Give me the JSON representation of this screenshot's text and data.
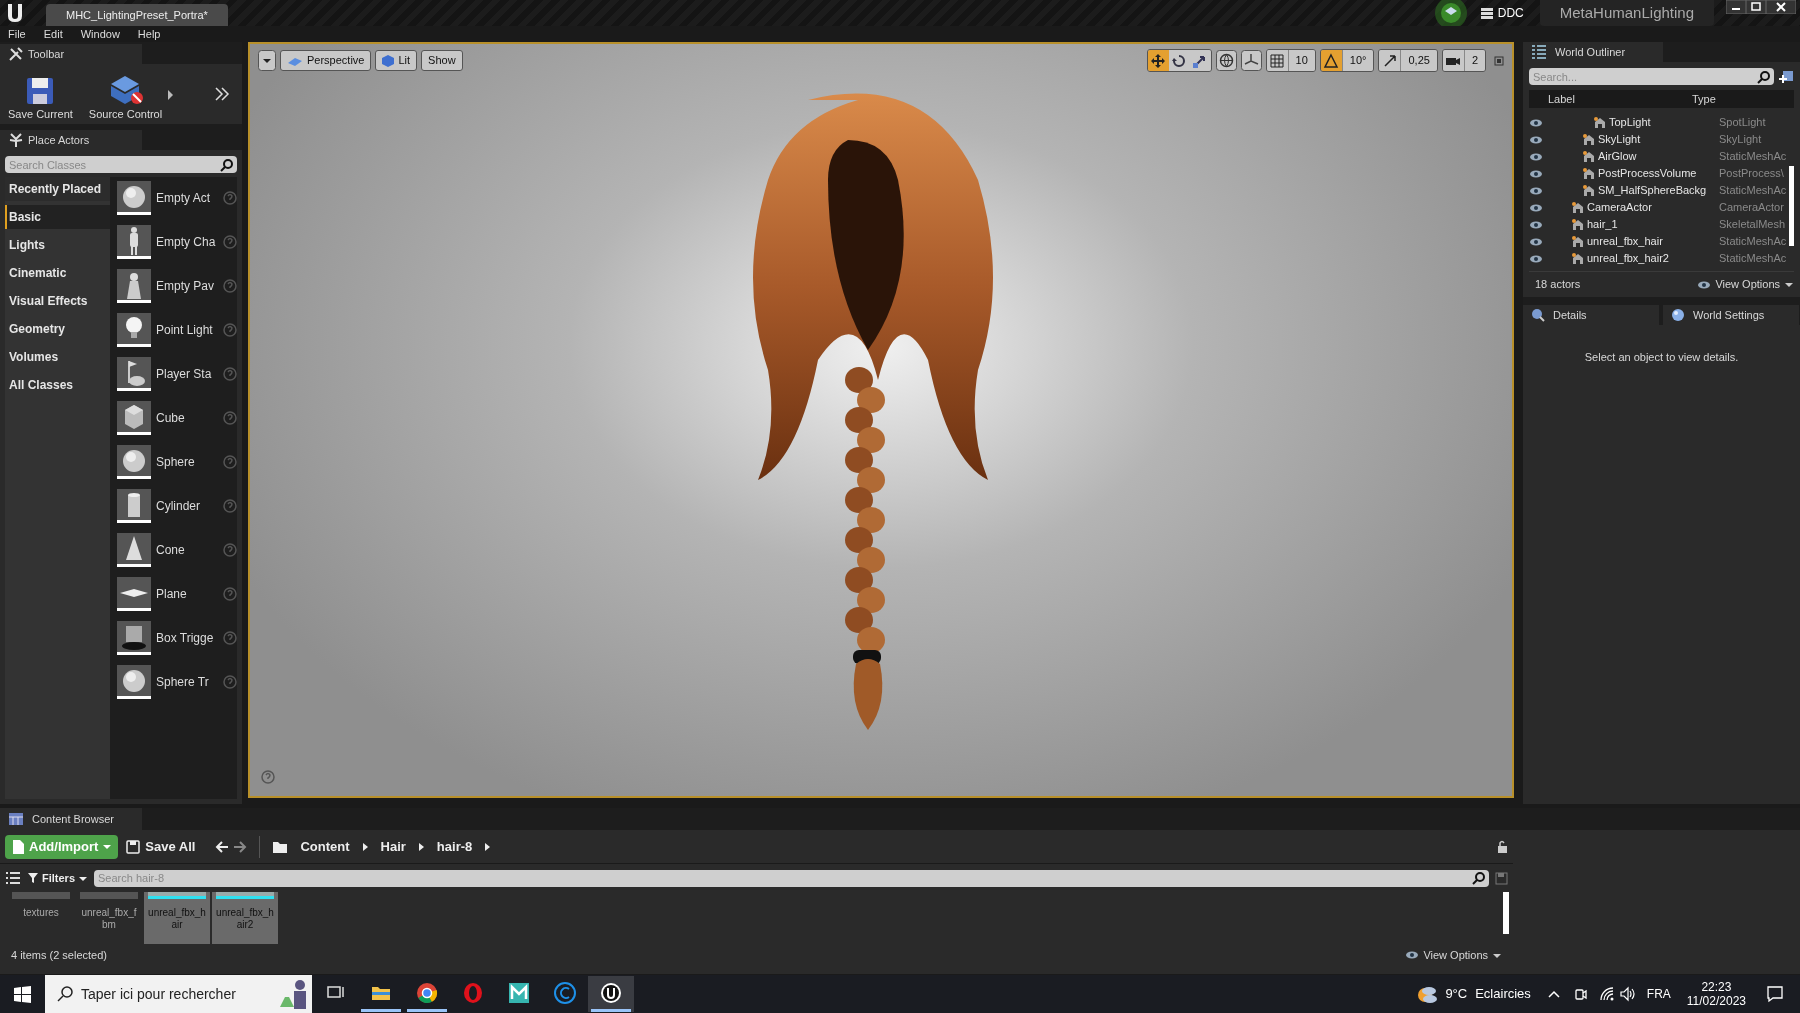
{
  "title_bar": {
    "tab": "MHC_LightingPreset_Portra*",
    "ddc": "DDC",
    "project": "MetaHumanLighting"
  },
  "menu": [
    "File",
    "Edit",
    "Window",
    "Help"
  ],
  "toolbar": {
    "tab": "Toolbar",
    "buttons": [
      {
        "label": "Save Current",
        "kind": "save"
      },
      {
        "label": "Source Control",
        "kind": "source"
      }
    ]
  },
  "place_actors": {
    "tab": "Place Actors",
    "search": {
      "placeholder": "Search Classes"
    },
    "categories": [
      {
        "label": "Recently Placed",
        "selected": false
      },
      {
        "label": "Basic",
        "selected": true
      },
      {
        "label": "Lights",
        "selected": false
      },
      {
        "label": "Cinematic",
        "selected": false
      },
      {
        "label": "Visual Effects",
        "selected": false
      },
      {
        "label": "Geometry",
        "selected": false
      },
      {
        "label": "Volumes",
        "selected": false
      },
      {
        "label": "All Classes",
        "selected": false
      }
    ],
    "items": [
      {
        "label": "Empty Act",
        "kind": "sphere"
      },
      {
        "label": "Empty Cha",
        "kind": "figure"
      },
      {
        "label": "Empty Pav",
        "kind": "pawn"
      },
      {
        "label": "Point Light",
        "kind": "bulb"
      },
      {
        "label": "Player Sta",
        "kind": "flag"
      },
      {
        "label": "Cube",
        "kind": "cube"
      },
      {
        "label": "Sphere",
        "kind": "sphere"
      },
      {
        "label": "Cylinder",
        "kind": "cylinder"
      },
      {
        "label": "Cone",
        "kind": "cone"
      },
      {
        "label": "Plane",
        "kind": "plane"
      },
      {
        "label": "Box Trigge",
        "kind": "box"
      },
      {
        "label": "Sphere Tr",
        "kind": "sphere"
      }
    ]
  },
  "viewport": {
    "buttons": [
      "Perspective",
      "Lit",
      "Show"
    ],
    "tools": [
      {
        "kind": "translate",
        "selected": true
      },
      {
        "kind": "rotate",
        "selected": false
      },
      {
        "kind": "scale",
        "selected": false
      }
    ],
    "snaps": [
      {
        "kind": "grid",
        "value": "10",
        "on": false
      },
      {
        "kind": "rotation",
        "value": "10°",
        "on": true
      },
      {
        "kind": "scale",
        "value": "0,25",
        "on": false
      },
      {
        "kind": "camera",
        "value": "2",
        "on": false
      }
    ]
  },
  "outliner": {
    "tab": "World Outliner",
    "search": {
      "placeholder": "Search..."
    },
    "columns": [
      "Label",
      "Type"
    ],
    "rows": [
      {
        "children": [
          {
            "children": [
              {
                "label": "TopLight",
                "type": "SpotLight",
                "visible": true
              }
            ]
          },
          {
            "label": "SkyLight",
            "type": "SkyLight",
            "visible": true
          },
          {
            "label": "AirGlow",
            "type": "StaticMeshAc",
            "visible": true
          },
          {
            "label": "PostProcessVolume",
            "type": "PostProcess\\",
            "visible": true
          },
          {
            "label": "SM_HalfSphereBackg",
            "type": "StaticMeshAc",
            "visible": true
          }
        ]
      },
      {
        "label": "CameraActor",
        "type": "CameraActor",
        "visible": true
      },
      {
        "label": "hair_1",
        "type": "SkeletalMesh",
        "visible": true
      },
      {
        "label": "unreal_fbx_hair",
        "type": "StaticMeshAc",
        "visible": true
      },
      {
        "label": "unreal_fbx_hair2",
        "type": "StaticMeshAc",
        "visible": true
      }
    ],
    "count": "18 actors",
    "view_options": "View Options"
  },
  "details": {
    "tabs": [
      "Details",
      "World Settings"
    ],
    "message": "Select an object to view details."
  },
  "content_browser": {
    "tab": "Content Browser",
    "add_import": "Add/Import",
    "save_all": "Save All",
    "path": [
      "Content",
      "Hair",
      "hair-8"
    ],
    "filters": "Filters",
    "search": {
      "placeholder": "Search hair-8"
    },
    "items": [
      {
        "label": "textures",
        "selected": false
      },
      {
        "label": "unreal_fbx_fbm",
        "selected": false
      },
      {
        "label": "unreal_fbx_hair",
        "selected": true
      },
      {
        "label": "unreal_fbx_hair2",
        "selected": true
      }
    ],
    "status": "4 items (2 selected)",
    "view_options": "View Options"
  },
  "taskbar": {
    "search": {
      "placeholder": "Taper ici pour rechercher"
    },
    "apps": [
      {
        "kind": "taskview",
        "active": false
      },
      {
        "kind": "folder",
        "active": true
      },
      {
        "kind": "chrome",
        "active": true
      },
      {
        "kind": "opera",
        "active": false
      },
      {
        "kind": "maya",
        "active": false
      },
      {
        "kind": "c",
        "active": false
      },
      {
        "kind": "unreal",
        "active": true
      }
    ],
    "temperature": "9°C",
    "weather": "Eclaircies",
    "language": "FRA",
    "time": "22:23",
    "date": "11/02/2023"
  }
}
